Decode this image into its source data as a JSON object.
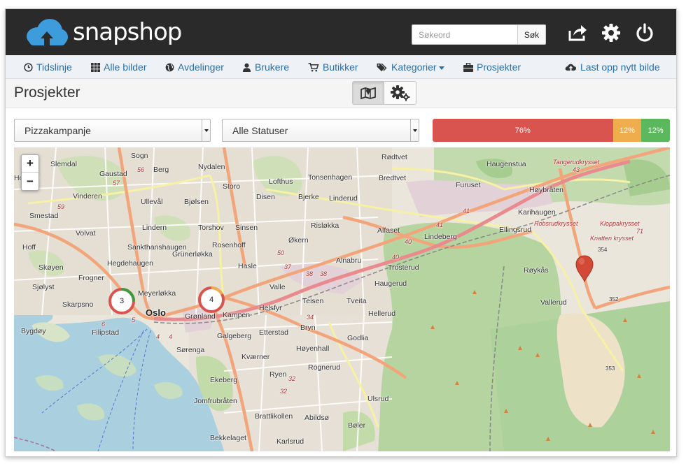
{
  "app": {
    "name": "snapshop"
  },
  "search": {
    "placeholder": "Søkeord",
    "button_label": "Søk"
  },
  "nav": {
    "items": [
      {
        "label": "Tidslinje",
        "icon": "clock-icon"
      },
      {
        "label": "Alle bilder",
        "icon": "grid-icon"
      },
      {
        "label": "Avdelinger",
        "icon": "globe-icon"
      },
      {
        "label": "Brukere",
        "icon": "user-icon"
      },
      {
        "label": "Butikker",
        "icon": "cart-icon"
      },
      {
        "label": "Kategorier",
        "icon": "tags-icon"
      },
      {
        "label": "Prosjekter",
        "icon": "briefcase-icon"
      },
      {
        "label": "Last opp nytt bilde",
        "icon": "cloud-upload-icon"
      }
    ]
  },
  "page": {
    "title": "Prosjekter"
  },
  "filters": {
    "project_selected": "Pizzakampanje",
    "status_selected": "Alle Statuser"
  },
  "status_bar": [
    {
      "label": "76%",
      "value": 76,
      "color": "#d9534f"
    },
    {
      "label": "12%",
      "value": 12,
      "color": "#f0ad4e"
    },
    {
      "label": "12%",
      "value": 12,
      "color": "#5cb85c"
    }
  ],
  "map": {
    "zoom_in": "+",
    "zoom_out": "−",
    "clusters": [
      {
        "count": "3"
      },
      {
        "count": "4"
      }
    ],
    "places": [
      "Sogn",
      "Slemdal",
      "Gaustad",
      "Berg",
      "Nydalen",
      "Holmen",
      "Vinderen",
      "Ullevål",
      "Bjølsen",
      "Storo",
      "Smestad",
      "Volvat",
      "Lindern",
      "Torshov",
      "Sinsen",
      "Hoff",
      "Sankthanshaugen",
      "Rosenhoff",
      "Skøyen",
      "Hegdehaugen",
      "Grünerløkka",
      "Hasle",
      "Frogner",
      "Meyerløkka",
      "Sjølyst",
      "Skarpsno",
      "Oslo",
      "Grønland",
      "Kampen",
      "Helsfyr",
      "Bygdøy",
      "Filipstad",
      "Sørenga",
      "Galgeberg",
      "Etterstad",
      "Kværner",
      "Ekeberg",
      "Ryen",
      "Jomfrubråten",
      "Brattlikollen",
      "Abildsø",
      "Bekkelaget",
      "Karlsrud",
      "Bøler",
      "Ulsrud",
      "Rognerud",
      "Høyenhall",
      "Godlia",
      "Bryn",
      "Teisen",
      "Tveita",
      "Hellerud",
      "Haugerud",
      "Trosterud",
      "Alnabru",
      "Økern",
      "Risløkka",
      "Linderud",
      "Bjerke",
      "Disen",
      "Lofthus",
      "Tonsenhagen",
      "Rødtvet",
      "Bredtvet",
      "Alfaset",
      "Lindeberg",
      "Furuset",
      "Haugenstua",
      "Høybråten",
      "Karihaugen",
      "Ellingsrud",
      "Røykås",
      "Vallerud",
      "Valle"
    ],
    "routes": [
      "5",
      "6",
      "4",
      "4",
      "57",
      "59",
      "56",
      "50",
      "37",
      "38",
      "38",
      "40",
      "40",
      "41",
      "41",
      "34",
      "32",
      "32",
      "43",
      "71",
      "354",
      "352",
      "353"
    ],
    "road_labels": [
      "Tangerudkrysset",
      "Robsrudkrysset",
      "Kloppakrysset",
      "Knatten krysset"
    ]
  }
}
